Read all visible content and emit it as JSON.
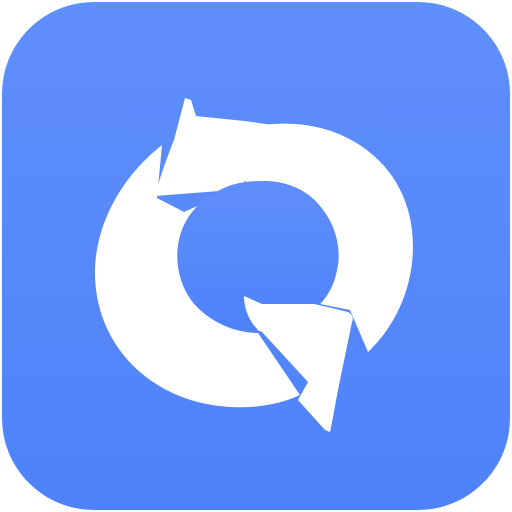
{
  "icon": {
    "name": "refresh-sync-icon",
    "tile_color": "#4e82f9",
    "tile_edge_color": "#5f8ffb",
    "glyph_color": "#ffffff"
  }
}
